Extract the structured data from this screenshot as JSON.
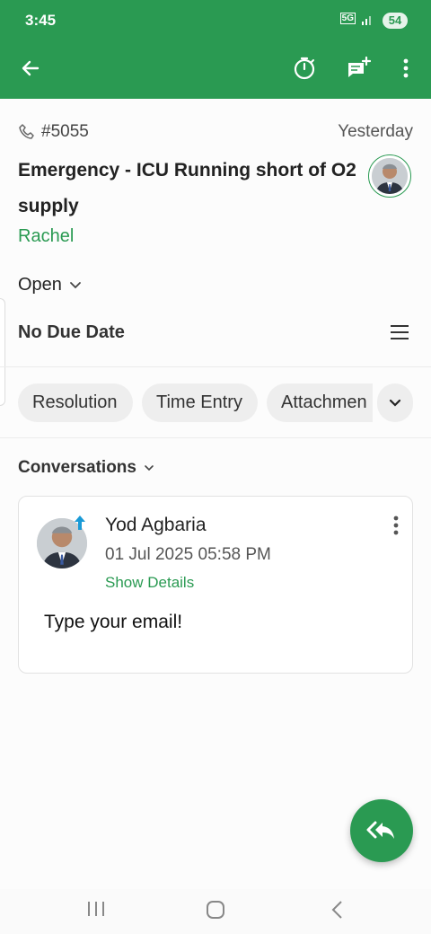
{
  "status_bar": {
    "time": "3:45",
    "network": "5G",
    "battery": "54"
  },
  "app_bar": {
    "icons": [
      "back-arrow-icon",
      "timer-icon",
      "add-comment-icon",
      "more-vertical-icon"
    ]
  },
  "ticket": {
    "number": "#5055",
    "date": "Yesterday",
    "subject": "Emergency - ICU Running short of O2 supply",
    "contact": "Rachel",
    "status": "Open",
    "due_date": "No Due Date"
  },
  "chips": [
    "Resolution",
    "Time Entry",
    "Attachmen"
  ],
  "conversations": {
    "header": "Conversations",
    "items": [
      {
        "sender": "Yod Agbaria",
        "datetime": "01 Jul 2025 05:58 PM",
        "details_link": "Show Details",
        "body": "Type your email!"
      }
    ]
  },
  "colors": {
    "primary": "#2a9a52",
    "background": "#fcfcfc"
  }
}
